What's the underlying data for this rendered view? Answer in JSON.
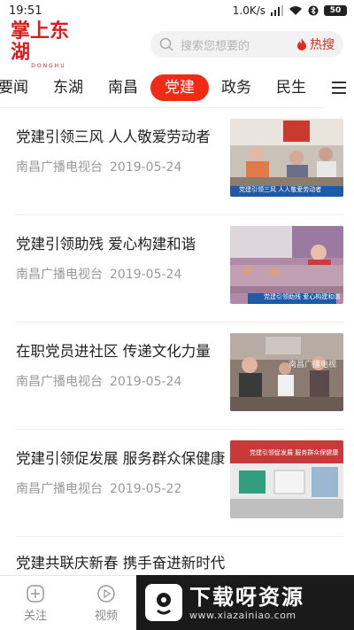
{
  "status_bar": {
    "time": "19:51",
    "speed": "1.0K/s",
    "battery": "50"
  },
  "header": {
    "logo_text": "掌上东湖",
    "logo_sub": "DONGHU",
    "search_placeholder": "搜索您想要的",
    "hot_label": "热搜"
  },
  "tabs": [
    {
      "label": "要闻"
    },
    {
      "label": "东湖"
    },
    {
      "label": "南昌"
    },
    {
      "label": "党建"
    },
    {
      "label": "政务"
    },
    {
      "label": "民生"
    }
  ],
  "articles": [
    {
      "title": "党建引领三风 人人敬爱劳动者",
      "source": "南昌广播电视台",
      "date": "2019-05-24",
      "thumb_caption": "党建引领三风  人人敬爱劳动者"
    },
    {
      "title": "党建引领助残 爱心构建和谐",
      "source": "南昌广播电视台",
      "date": "2019-05-24",
      "thumb_caption": "党建引领助残  爱心构建和谐"
    },
    {
      "title": "在职党员进社区 传递文化力量",
      "source": "南昌广播电视台",
      "date": "2019-05-24",
      "thumb_caption": "南昌广播电视"
    },
    {
      "title": "党建引领促发展 服务群众保健康",
      "source": "南昌广播电视台",
      "date": "2019-05-22",
      "thumb_caption": "党建引领促发展  服务群众保健康"
    },
    {
      "title": "党建共联庆新春 携手奋进新时代"
    }
  ],
  "bottom_nav": [
    {
      "label": "关注",
      "icon": "plus-circle-icon"
    },
    {
      "label": "视频",
      "icon": "play-circle-icon"
    }
  ],
  "watermark": {
    "title": "下载呀资源",
    "url": "www.xiazainiao.com"
  },
  "colors": {
    "accent": "#ef2b17",
    "logo_red": "#d81e1e"
  }
}
